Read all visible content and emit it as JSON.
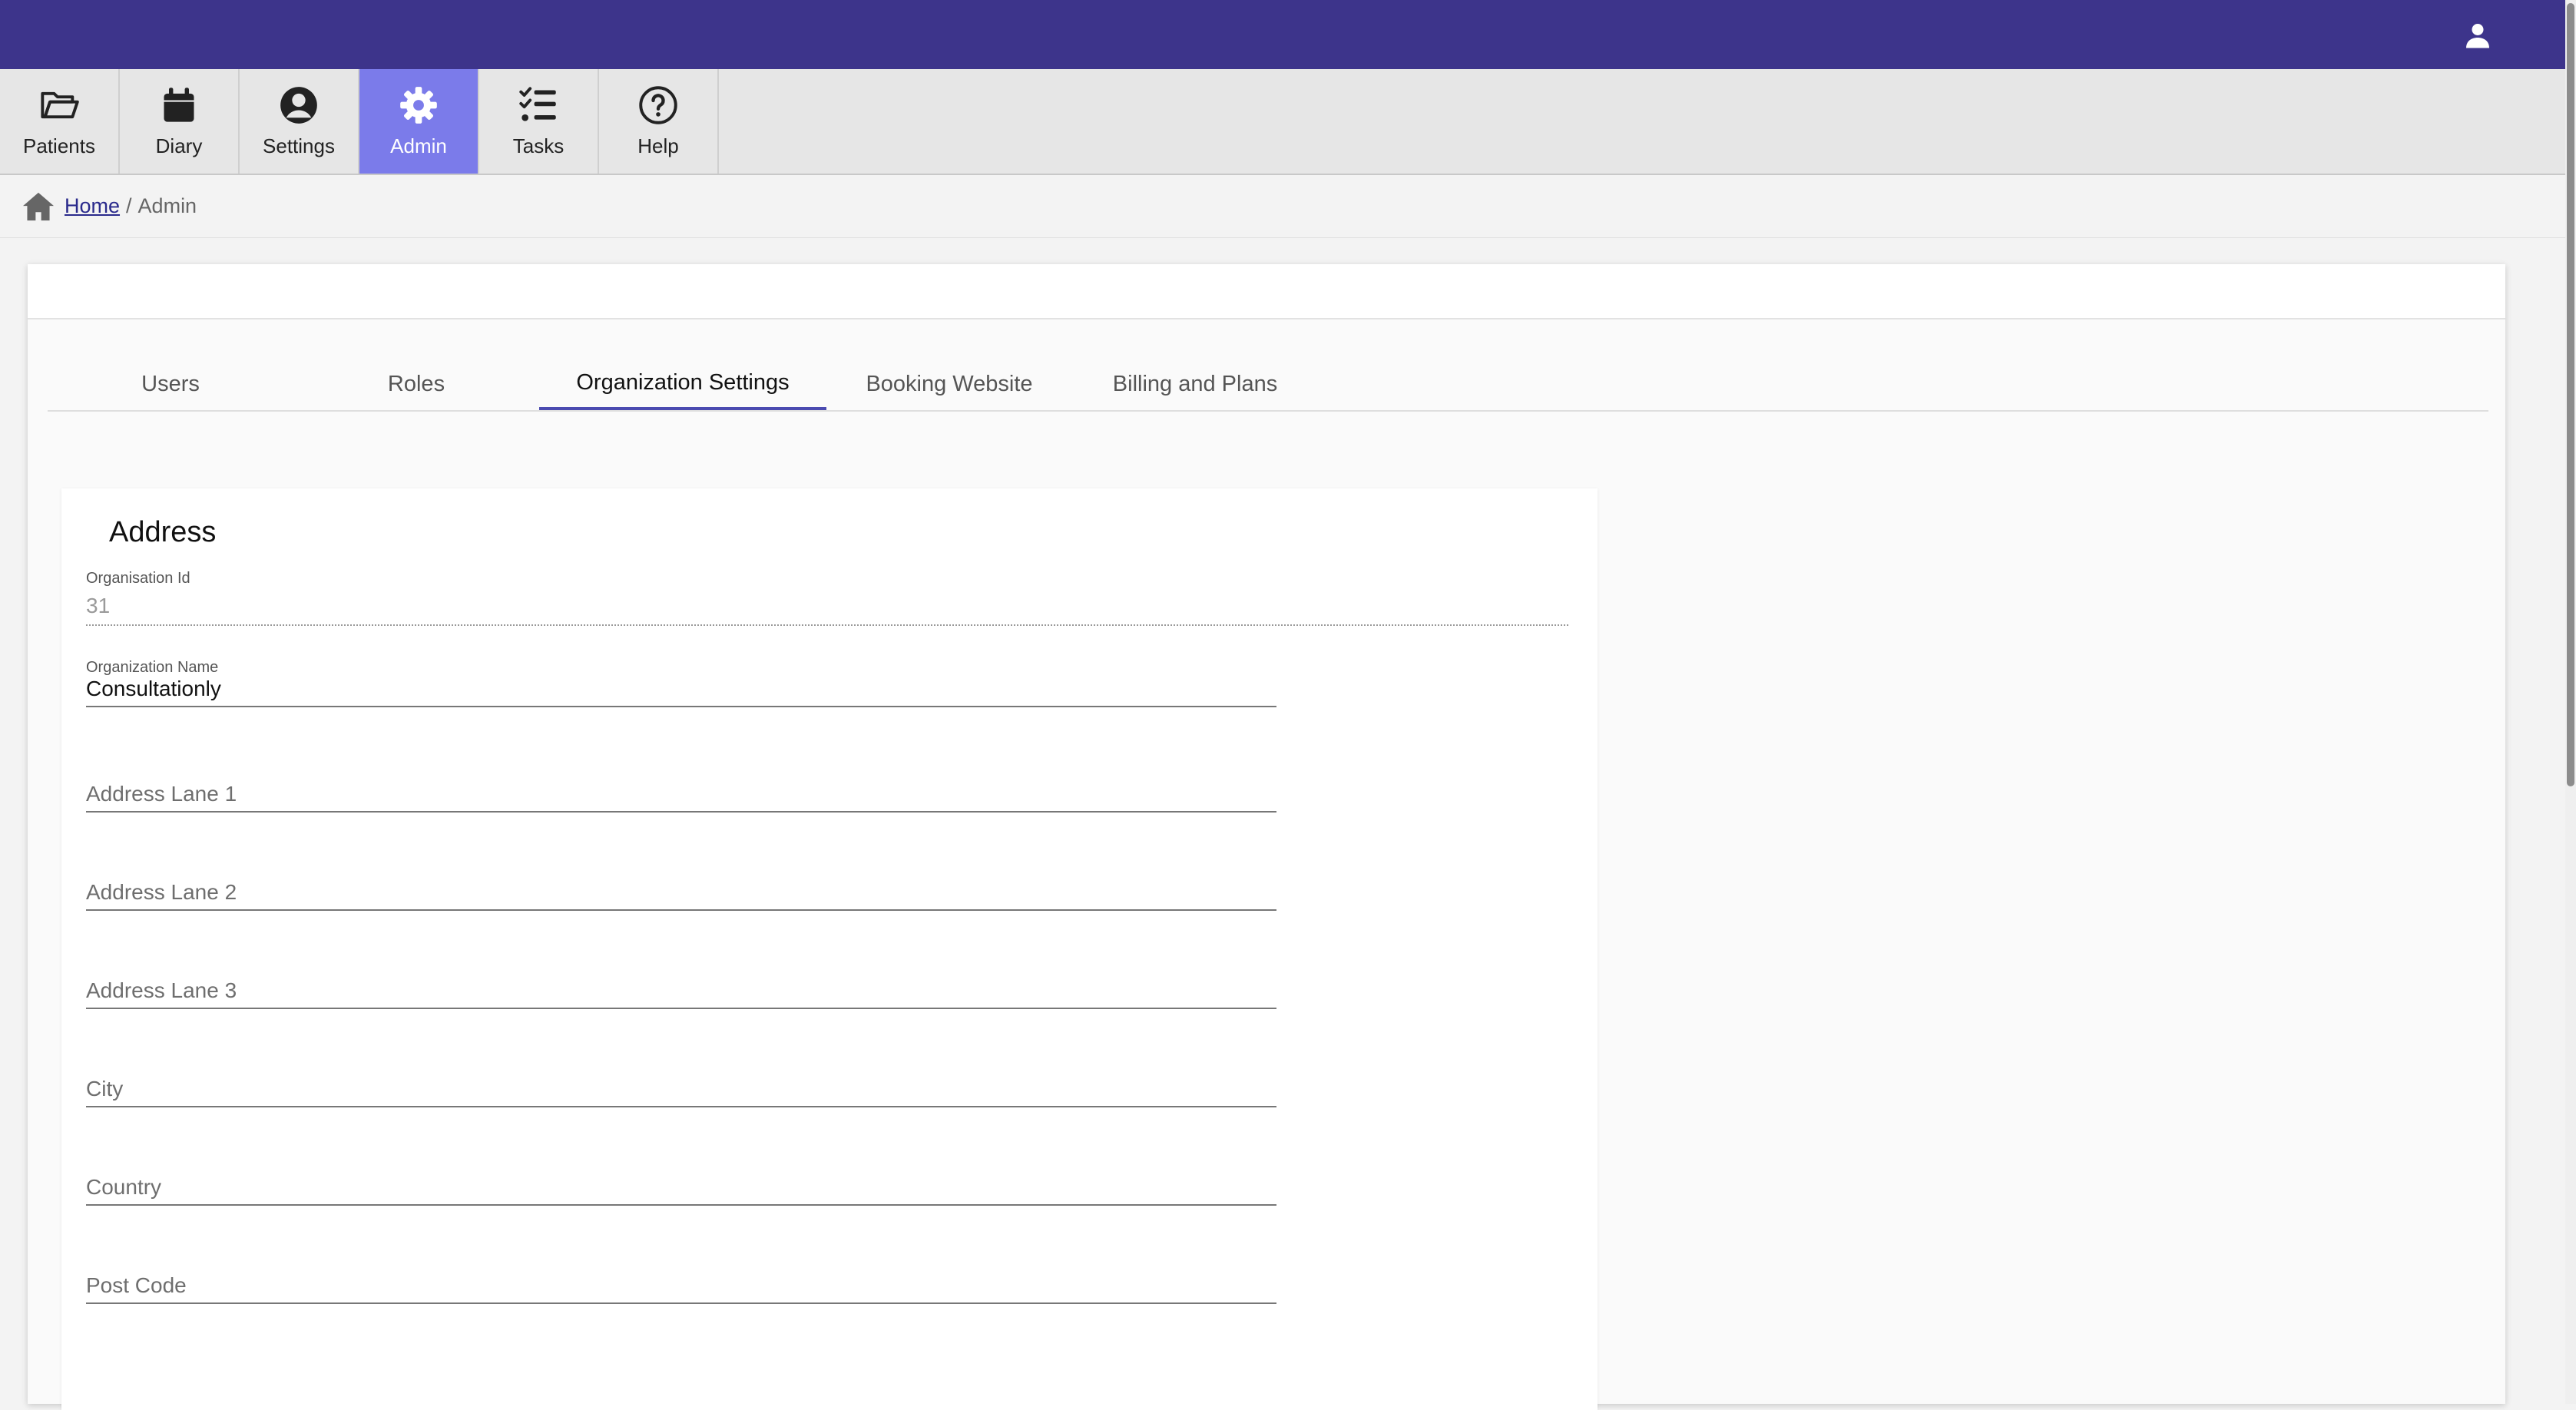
{
  "nav": {
    "items": [
      {
        "label": "Patients",
        "icon": "folder-open-icon"
      },
      {
        "label": "Diary",
        "icon": "calendar-icon"
      },
      {
        "label": "Settings",
        "icon": "user-circle-icon"
      },
      {
        "label": "Admin",
        "icon": "gear-icon"
      },
      {
        "label": "Tasks",
        "icon": "list-check-icon"
      },
      {
        "label": "Help",
        "icon": "question-circle-icon"
      }
    ],
    "active": "Admin"
  },
  "breadcrumb": {
    "home": "Home",
    "separator": "/",
    "current": "Admin"
  },
  "tabs": [
    "Users",
    "Roles",
    "Organization Settings",
    "Booking Website",
    "Billing and Plans"
  ],
  "active_tab": "Organization Settings",
  "address": {
    "title": "Address",
    "org_id": {
      "label": "Organisation Id",
      "value": "31"
    },
    "org_name": {
      "label": "Organization Name",
      "value": "Consultationly"
    },
    "fields": {
      "address1": "Address Lane 1",
      "address2": "Address Lane 2",
      "address3": "Address Lane 3",
      "city": "City",
      "country": "Country",
      "postcode": "Post Code"
    }
  },
  "colors": {
    "header": "#3d348b",
    "active_nav": "#7b7bea",
    "tab_indicator": "#4a4ab0"
  }
}
